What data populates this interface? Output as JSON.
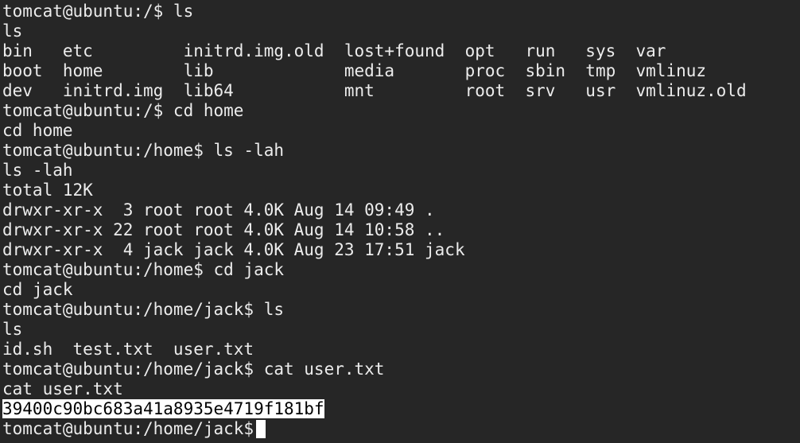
{
  "terminal": {
    "lines": [
      "tomcat@ubuntu:/$ ls",
      "ls",
      "bin   etc         initrd.img.old  lost+found  opt   run   sys  var",
      "boot  home        lib             media       proc  sbin  tmp  vmlinuz",
      "dev   initrd.img  lib64           mnt         root  srv   usr  vmlinuz.old",
      "tomcat@ubuntu:/$ cd home",
      "cd home",
      "tomcat@ubuntu:/home$ ls -lah",
      "ls -lah",
      "total 12K",
      "drwxr-xr-x  3 root root 4.0K Aug 14 09:49 .",
      "drwxr-xr-x 22 root root 4.0K Aug 14 10:58 ..",
      "drwxr-xr-x  4 jack jack 4.0K Aug 23 17:51 jack",
      "tomcat@ubuntu:/home$ cd jack",
      "cd jack",
      "tomcat@ubuntu:/home/jack$ ls",
      "ls",
      "id.sh  test.txt  user.txt",
      "tomcat@ubuntu:/home/jack$ cat user.txt",
      "cat user.txt"
    ],
    "flag_output": "39400c90bc683a41a8935e4719f181bf",
    "current_prompt": "tomcat@ubuntu:/home/jack$"
  }
}
